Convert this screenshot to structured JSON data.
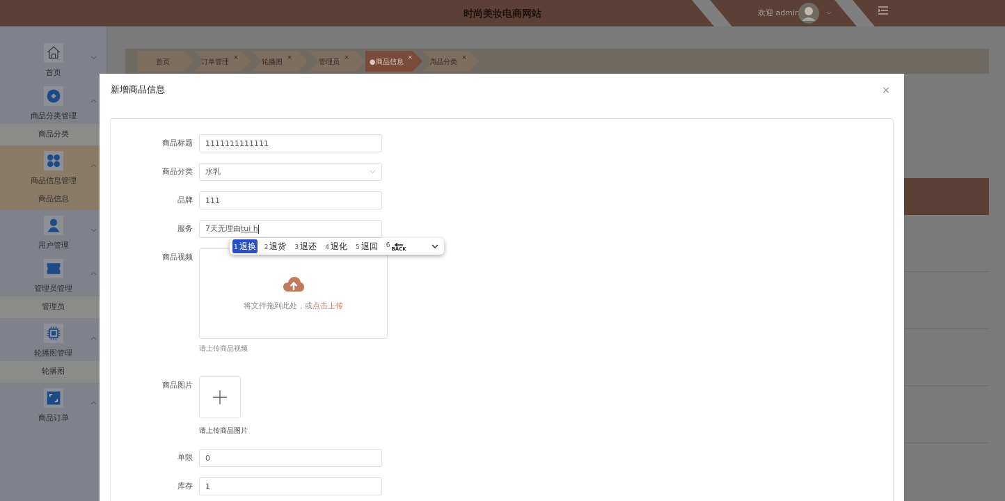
{
  "header": {
    "title": "时尚美妆电商网站",
    "welcome": "欢迎 admin"
  },
  "sidebar": {
    "items": [
      {
        "label": "首页",
        "expanded": false,
        "selected": false
      },
      {
        "label": "商品分类管理",
        "expanded": true,
        "selected": false,
        "children": [
          {
            "label": "商品分类",
            "selected": false
          }
        ]
      },
      {
        "label": "商品信息管理",
        "expanded": true,
        "selected": true,
        "children": [
          {
            "label": "商品信息",
            "selected": true
          }
        ]
      },
      {
        "label": "用户管理",
        "expanded": false,
        "selected": false
      },
      {
        "label": "管理员管理",
        "expanded": true,
        "selected": false,
        "children": [
          {
            "label": "管理员",
            "selected": false
          }
        ]
      },
      {
        "label": "轮播图管理",
        "expanded": true,
        "selected": false,
        "children": [
          {
            "label": "轮播图",
            "selected": false
          }
        ]
      },
      {
        "label": "商品订单",
        "expanded": true,
        "selected": false
      }
    ]
  },
  "tabs": [
    {
      "label": "首页",
      "selected": false
    },
    {
      "label": "订单管理",
      "close": "×",
      "selected": false
    },
    {
      "label": "轮播图",
      "close": "×",
      "selected": false
    },
    {
      "label": "管理员",
      "close": "×",
      "selected": false
    },
    {
      "label": "商品信息",
      "bullet": "●",
      "close": "×",
      "selected": true
    },
    {
      "label": "商品分类",
      "close": "×",
      "selected": false
    }
  ],
  "modal": {
    "title": "新增商品信息",
    "close": "×",
    "fields": [
      {
        "kind": "text",
        "label": "商品标题",
        "value": "1111111111111"
      },
      {
        "kind": "select",
        "label": "商品分类",
        "value": "水乳"
      },
      {
        "kind": "text",
        "label": "品牌",
        "value": "111"
      },
      {
        "kind": "composing",
        "label": "服务",
        "value": "7天无理由",
        "composing": "tui h"
      },
      {
        "kind": "video",
        "label": "商品视频",
        "prompt": "将文件拖到此处，或",
        "link": "点击上传",
        "hint": "请上传商品视频"
      },
      {
        "kind": "image",
        "label": "商品图片",
        "hint": "请上传商品图片"
      },
      {
        "kind": "text",
        "label": "单限",
        "value": "0"
      },
      {
        "kind": "text",
        "label": "库存",
        "value": "1"
      }
    ]
  },
  "ime": {
    "candidates": [
      {
        "index": "1",
        "text": "退换",
        "kind": "word",
        "selected": true
      },
      {
        "index": "2",
        "text": "退货",
        "kind": "word",
        "selected": false
      },
      {
        "index": "3",
        "text": "退还",
        "kind": "word",
        "selected": false
      },
      {
        "index": "4",
        "text": "退化",
        "kind": "word",
        "selected": false
      },
      {
        "index": "5",
        "text": "退回",
        "kind": "word",
        "selected": false
      },
      {
        "index": "6",
        "text": "BACK",
        "kind": "emoji",
        "selected": false
      }
    ]
  }
}
